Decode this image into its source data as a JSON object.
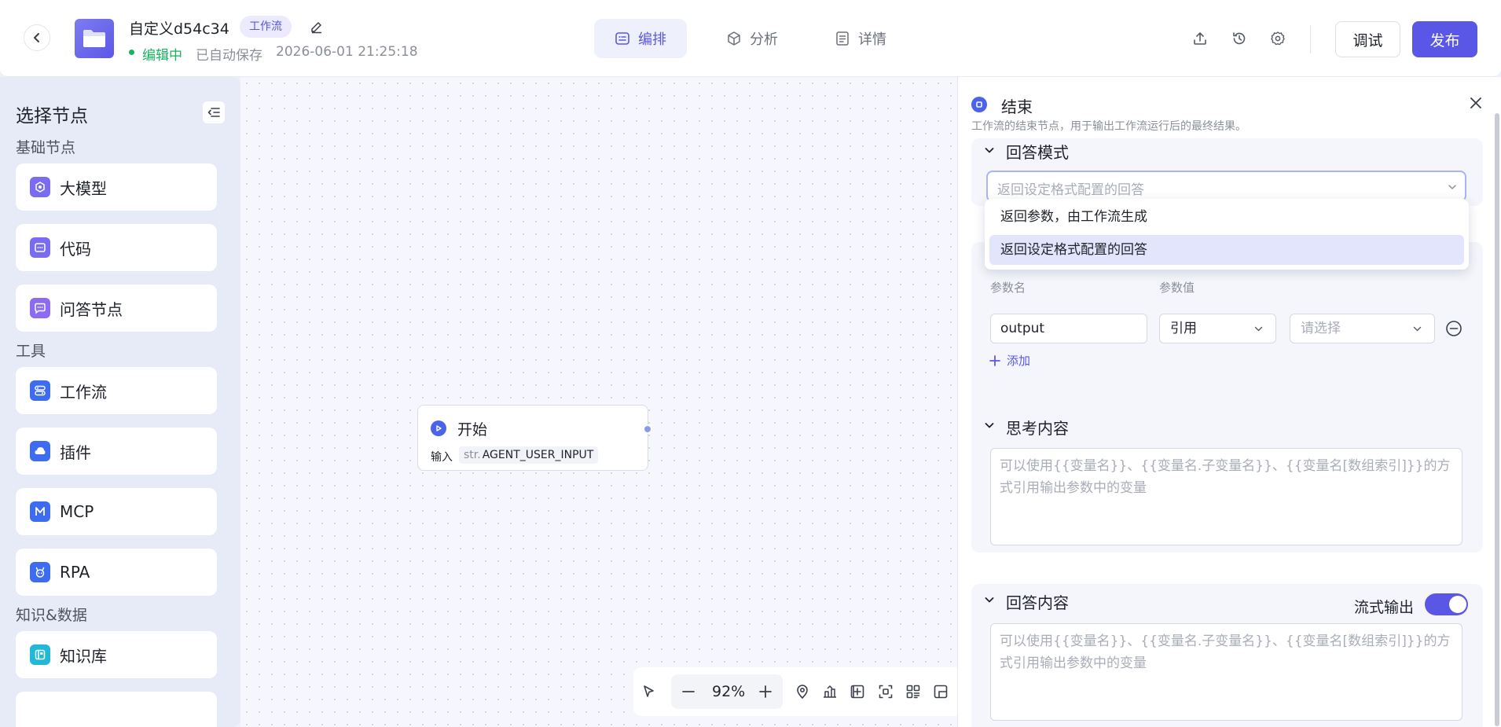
{
  "header": {
    "app_title": "自定义d54c34",
    "type_tag": "工作流",
    "status": "编辑中",
    "autosave": "已自动保存",
    "save_time": "2026-06-01 21:25:18",
    "tabs": [
      {
        "label": "编排",
        "icon": "layout-icon",
        "active": true
      },
      {
        "label": "分析",
        "icon": "cube-icon",
        "active": false
      },
      {
        "label": "详情",
        "icon": "document-icon",
        "active": false
      }
    ],
    "debug_label": "调试",
    "publish_label": "发布"
  },
  "sidebar": {
    "title": "选择节点",
    "sections": [
      {
        "label": "基础节点",
        "items": [
          {
            "label": "大模型",
            "icon": "llm-icon",
            "color": "#7a6cf0"
          },
          {
            "label": "代码",
            "icon": "code-icon",
            "color": "#7a6cf0"
          },
          {
            "label": "问答节点",
            "icon": "chat-icon",
            "color": "#8b6cf0"
          }
        ]
      },
      {
        "label": "工具",
        "items": [
          {
            "label": "工作流",
            "icon": "workflow-icon",
            "color": "#3d6cf0"
          },
          {
            "label": "插件",
            "icon": "plugin-icon",
            "color": "#3d6cf0"
          },
          {
            "label": "MCP",
            "icon": "mcp-icon",
            "color": "#3d6cf0"
          },
          {
            "label": "RPA",
            "icon": "rpa-icon",
            "color": "#3d6cf0"
          }
        ]
      },
      {
        "label": "知识&数据",
        "items": [
          {
            "label": "知识库",
            "icon": "knowledge-base-icon",
            "color": "#22b8d8"
          }
        ]
      }
    ]
  },
  "canvas": {
    "start_node": {
      "title": "开始",
      "input_label": "输入",
      "var_type": "str.",
      "var_name": "AGENT_USER_INPUT"
    },
    "zoom": "92%"
  },
  "panel": {
    "title": "结束",
    "description": "工作流的结束节点，用于输出工作流运行后的最终结果。",
    "answer_mode": {
      "title": "回答模式",
      "placeholder": "返回设定格式配置的回答",
      "options": [
        "返回参数，由工作流生成",
        "返回设定格式配置的回答"
      ],
      "selected_index": 1
    },
    "params": {
      "name_header": "参数名",
      "value_header": "参数值",
      "row": {
        "name": "output",
        "ref_type": "引用",
        "ref_placeholder": "请选择"
      },
      "add_label": "添加"
    },
    "thinking": {
      "title": "思考内容",
      "placeholder": "可以使用{{变量名}}、{{变量名.子变量名}}、{{变量名[数组索引]}}的方式引用输出参数中的变量"
    },
    "answer": {
      "title": "回答内容",
      "stream_label": "流式输出",
      "stream_enabled": true,
      "placeholder": "可以使用{{变量名}}、{{变量名.子变量名}}、{{变量名[数组索引]}}的方式引用输出参数中的变量"
    }
  },
  "colors": {
    "accent": "#5b57e6",
    "status_green": "#19b35f",
    "node_blue": "#4b63e8"
  }
}
